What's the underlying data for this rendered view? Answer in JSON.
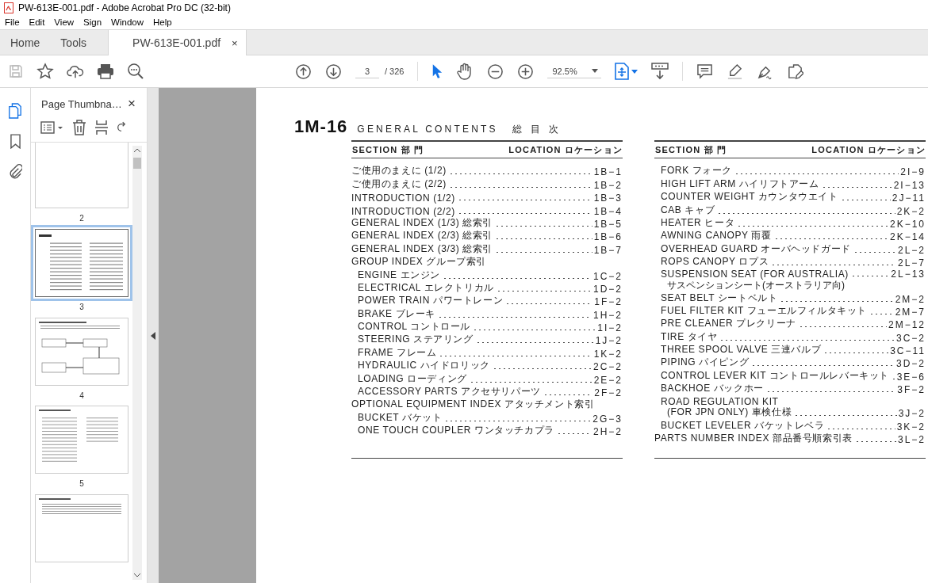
{
  "window": {
    "title": "PW-613E-001.pdf - Adobe Acrobat Pro DC (32-bit)"
  },
  "menu": [
    "File",
    "Edit",
    "View",
    "Sign",
    "Window",
    "Help"
  ],
  "tabs": [
    {
      "label": "Home",
      "selected": false
    },
    {
      "label": "Tools",
      "selected": false
    },
    {
      "label": "PW-613E-001.pdf",
      "selected": true,
      "close": "×"
    }
  ],
  "toolbar": {
    "page": "3",
    "page_count": "/ 326",
    "zoom": "92.5%"
  },
  "thumbnail_panel": {
    "title": "Page Thumbna…",
    "close": "×",
    "pages": [
      {
        "label": "2",
        "selected": false,
        "kind": "blank"
      },
      {
        "label": "3",
        "selected": true,
        "kind": "contents"
      },
      {
        "label": "4",
        "selected": false,
        "kind": "diagram"
      },
      {
        "label": "5",
        "selected": false,
        "kind": "list"
      },
      {
        "kind": "text",
        "selected": false
      }
    ]
  },
  "document": {
    "code": "1M-16",
    "title": "GENERAL CONTENTS",
    "title_jp": "総 目 次",
    "columns": [
      {
        "section_header": "SECTION 部 門",
        "location_header": "LOCATION ロケーション",
        "entries": [
          {
            "label": "ご使用のまえに (1/2)",
            "location": "1B−1"
          },
          {
            "label": "ご使用のまえに (2/2)",
            "location": "1B−2"
          },
          {
            "label": "INTRODUCTION (1/2)",
            "location": "1B−3"
          },
          {
            "label": "INTRODUCTION (2/2)",
            "location": "1B−4"
          },
          {
            "label": "GENERAL INDEX (1/3)  総索引",
            "location": "1B−5"
          },
          {
            "label": "GENERAL INDEX (2/3)  総索引",
            "location": "1B−6"
          },
          {
            "label": "GENERAL INDEX (3/3)  総索引",
            "location": "1B−7"
          },
          {
            "label": "GROUP INDEX グループ索引",
            "children": [
              {
                "label": "ENGINE エンジン",
                "location": "1C−2"
              },
              {
                "label": "ELECTRICAL エレクトリカル",
                "location": "1D−2"
              },
              {
                "label": "POWER TRAIN パワートレーン",
                "location": "1F−2"
              },
              {
                "label": "BRAKE ブレーキ",
                "location": "1H−2"
              },
              {
                "label": "CONTROL コントロール",
                "location": "1I−2"
              },
              {
                "label": "STEERING ステアリング",
                "location": "1J−2"
              },
              {
                "label": "FRAME フレーム",
                "location": "1K−2"
              },
              {
                "label": "HYDRAULIC ハイドロリック",
                "location": "2C−2"
              },
              {
                "label": "LOADING ローディング",
                "location": "2E−2"
              },
              {
                "label": "ACCESSORY PARTS アクセサリパーツ",
                "location": "2F−2"
              }
            ]
          },
          {
            "label": "OPTIONAL EQUIPMENT INDEX アタッチメント索引",
            "children": [
              {
                "label": "BUCKET バケット",
                "location": "2G−3"
              },
              {
                "label": "ONE TOUCH COUPLER ワンタッチカプラ",
                "location": "2H−2"
              }
            ]
          }
        ]
      },
      {
        "section_header": "SECTION 部 門",
        "location_header": "LOCATION ロケーション",
        "entries": [
          {
            "children": [
              {
                "label": "FORK フォーク",
                "location": "2I−9"
              },
              {
                "label": "HIGH LIFT ARM ハイリフトアーム",
                "location": "2I−13"
              },
              {
                "label": "COUNTER WEIGHT カウンタウエイト",
                "location": "2J−11"
              },
              {
                "label": "CAB キャブ",
                "location": "2K−2"
              },
              {
                "label": "HEATER ヒータ",
                "location": "2K−10"
              },
              {
                "label": "AWNING CANOPY 雨覆",
                "location": "2K−14"
              },
              {
                "label": "OVERHEAD GUARD オーバヘッドガード",
                "location": "2L−2"
              },
              {
                "label": "ROPS CANOPY ロプス",
                "location": "2L−7"
              },
              {
                "label": "SUSPENSION SEAT (FOR AUSTRALIA)",
                "note": "サスペンションシート(オーストラリア向)",
                "location": "2L−13"
              },
              {
                "label": "SEAT BELT シートベルト",
                "location": "2M−2"
              },
              {
                "label": "FUEL FILTER KIT フューエルフィルタキット",
                "location": "2M−7"
              },
              {
                "label": "PRE CLEANER プレクリーナ",
                "location": "2M−12"
              },
              {
                "label": "TIRE タイヤ",
                "location": "3C−2"
              },
              {
                "label": "THREE SPOOL VALVE 三連バルブ",
                "location": "3C−11"
              },
              {
                "label": "PIPING パイピング",
                "location": "3D−2"
              },
              {
                "label": "CONTROL LEVER KIT コントロールレバーキット",
                "location": "3E−6"
              },
              {
                "label": "BACKHOE バックホー",
                "location": "3F−2"
              },
              {
                "heading": "ROAD REGULATION KIT",
                "label": "(FOR JPN ONLY) 車検仕様",
                "location": "3J−2"
              },
              {
                "label": "BUCKET LEVELER バケットレベラ",
                "location": "3K−2"
              }
            ]
          },
          {
            "label": "PARTS NUMBER INDEX 部品番号順索引表",
            "location": "3L−2"
          }
        ]
      }
    ]
  }
}
